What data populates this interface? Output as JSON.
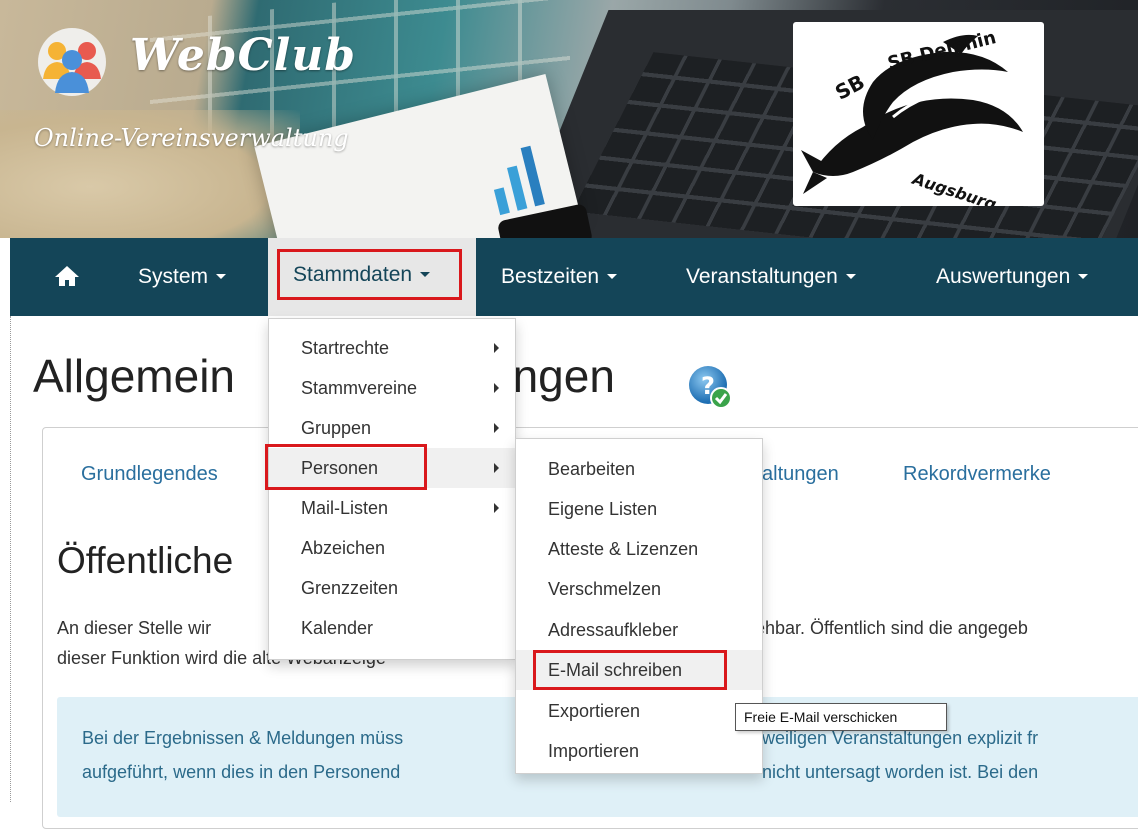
{
  "header": {
    "brand_title": "WebClub",
    "brand_subtitle": "Online-Vereinsverwaltung",
    "club_logo_text_top": "SB Delphin",
    "club_logo_text_bottom": "Augsburg"
  },
  "nav": {
    "items": [
      {
        "label": "System"
      },
      {
        "label": "Stammdaten"
      },
      {
        "label": "Bestzeiten"
      },
      {
        "label": "Veranstaltungen"
      },
      {
        "label": "Auswertungen"
      }
    ]
  },
  "page": {
    "title": "Allgemeine Einstellungen",
    "title_visible_left": "Allgemein",
    "title_visible_right": "ungen",
    "tabs": [
      {
        "label": "Grundlegendes"
      },
      {
        "label": "altungen"
      },
      {
        "label": "Rekordvermerke"
      }
    ],
    "section_title": "Öffentliche",
    "para_line1_left": "An dieser Stelle wir",
    "para_line1_right": "sehbar. Öffentlich sind die angegeb",
    "para_line2": "dieser Funktion wird die alte Webanzeige",
    "info_line1_left": "Bei der Ergebnissen & Meldungen müss",
    "info_line1_right": "weiligen Veranstaltungen explizit fr",
    "info_line2_left": "aufgeführt, wenn dies in den Personend",
    "info_line2_right": "nicht untersagt worden ist. Bei den"
  },
  "menu_stammdaten": {
    "items": [
      {
        "label": "Startrechte",
        "has_submenu": true
      },
      {
        "label": "Stammvereine",
        "has_submenu": true
      },
      {
        "label": "Gruppen",
        "has_submenu": true
      },
      {
        "label": "Personen",
        "has_submenu": true
      },
      {
        "label": "Mail-Listen",
        "has_submenu": true
      },
      {
        "label": "Abzeichen",
        "has_submenu": false
      },
      {
        "label": "Grenzzeiten",
        "has_submenu": false
      },
      {
        "label": "Kalender",
        "has_submenu": false
      }
    ]
  },
  "menu_personen": {
    "items": [
      {
        "label": "Bearbeiten"
      },
      {
        "label": "Eigene Listen"
      },
      {
        "label": "Atteste & Lizenzen"
      },
      {
        "label": "Verschmelzen"
      },
      {
        "label": "Adressaufkleber"
      },
      {
        "label": "E-Mail schreiben"
      },
      {
        "label": "Exportieren"
      },
      {
        "label": "Importieren"
      }
    ]
  },
  "tooltip": {
    "text": "Freie E-Mail verschicken"
  },
  "colors": {
    "navbar": "#144558",
    "highlight_border": "#d9181c",
    "link": "#2a6f9e",
    "info_bg": "#dff0f7"
  }
}
